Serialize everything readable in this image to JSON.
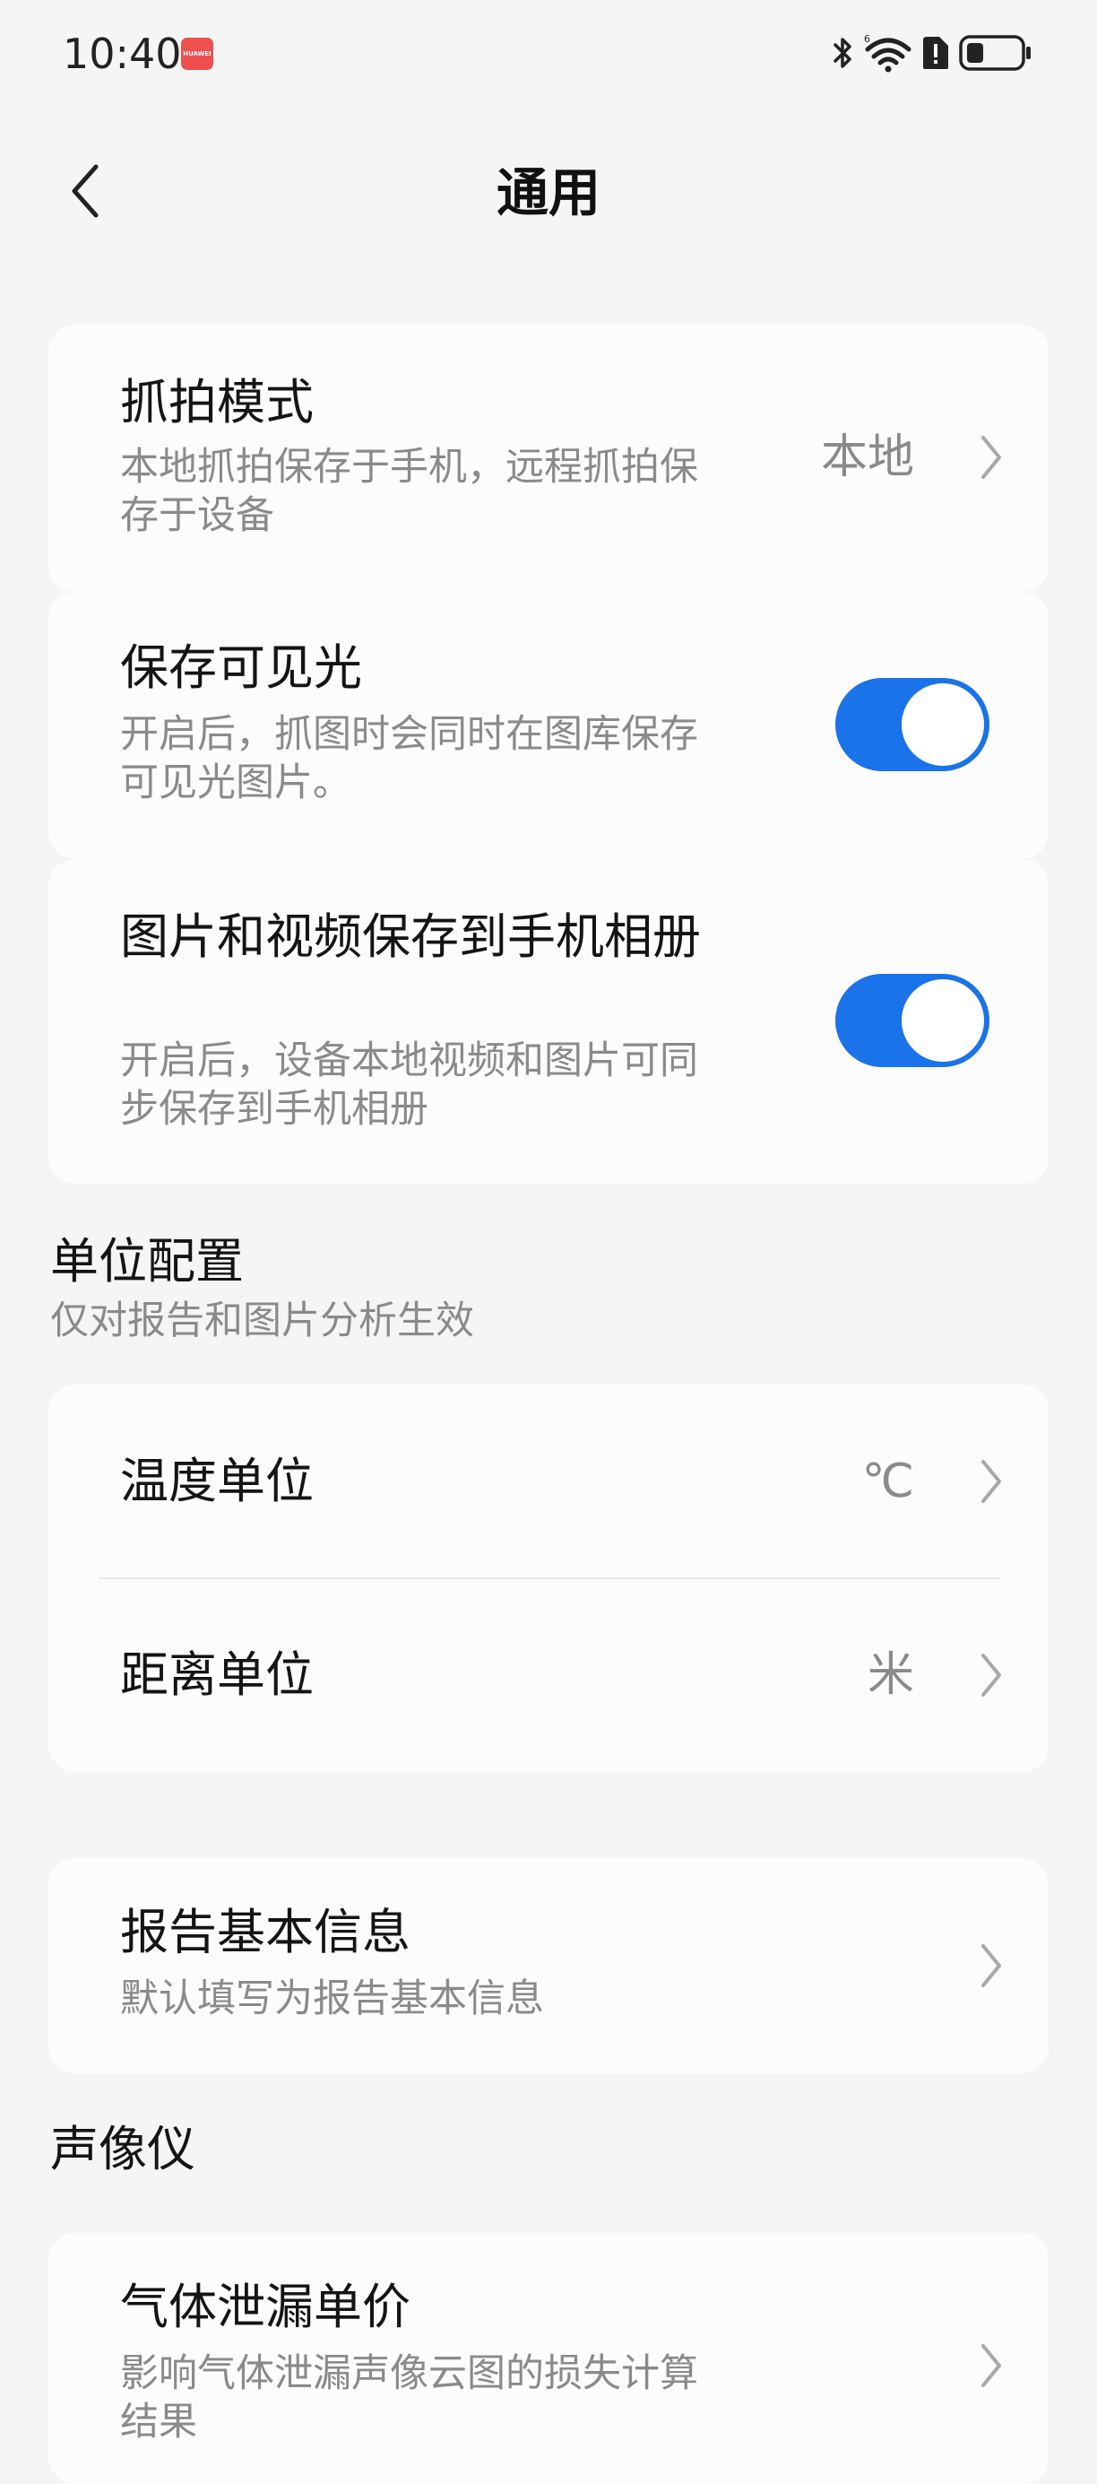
{
  "status_bar": {
    "time": "10:40",
    "badge_text": "HUAWEI",
    "icons": [
      "bluetooth-icon",
      "wifi-6-icon",
      "alert-icon",
      "battery-icon"
    ]
  },
  "header": {
    "title": "通用",
    "back_icon": "back-arrow-icon"
  },
  "general_settings": {
    "capture_mode": {
      "title": "抓拍模式",
      "description": "本地抓拍保存于手机，远程抓拍保存于设备",
      "value": "本地"
    },
    "save_visible_light": {
      "title": "保存可见光",
      "description": "开启后，抓图时会同时在图库保存可见光图片。",
      "enabled": true
    },
    "save_to_album": {
      "title": "图片和视频保存到手机相册",
      "description": "开启后，设备本地视频和图片可同步保存到手机相册",
      "enabled": true
    }
  },
  "unit_section": {
    "title": "单位配置",
    "subtitle": "仅对报告和图片分析生效",
    "temperature": {
      "label": "温度单位",
      "value": "℃"
    },
    "distance": {
      "label": "距离单位",
      "value": "米"
    }
  },
  "report_info": {
    "title": "报告基本信息",
    "description": "默认填写为报告基本信息"
  },
  "imager_section": {
    "title": "声像仪",
    "gas_leak_price": {
      "title": "气体泄漏单价",
      "description": "影响气体泄漏声像云图的损失计算结果"
    }
  },
  "colors": {
    "toggle_on": "#1a73e8",
    "background": "#f5f5f5",
    "card": "#fcfcfc",
    "secondary_text": "#8a8a8a"
  }
}
